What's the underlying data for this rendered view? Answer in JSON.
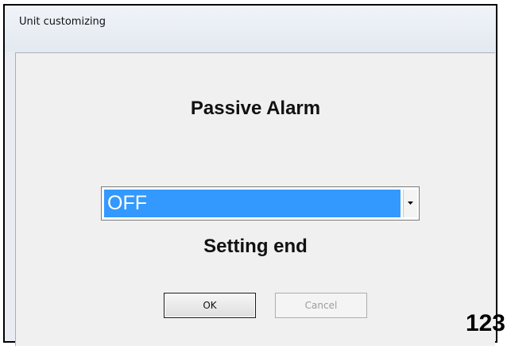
{
  "window": {
    "title": "Unit customizing"
  },
  "dialog": {
    "heading": "Passive Alarm",
    "dropdown": {
      "selected_value": "OFF",
      "arrow_icon": "chevron-down-icon"
    },
    "status_text": "Setting end",
    "buttons": {
      "ok_label": "OK",
      "cancel_label": "Cancel"
    }
  },
  "page_number": "123",
  "colors": {
    "selection_highlight": "#3399ff",
    "disabled_text": "#9c9c9c"
  }
}
